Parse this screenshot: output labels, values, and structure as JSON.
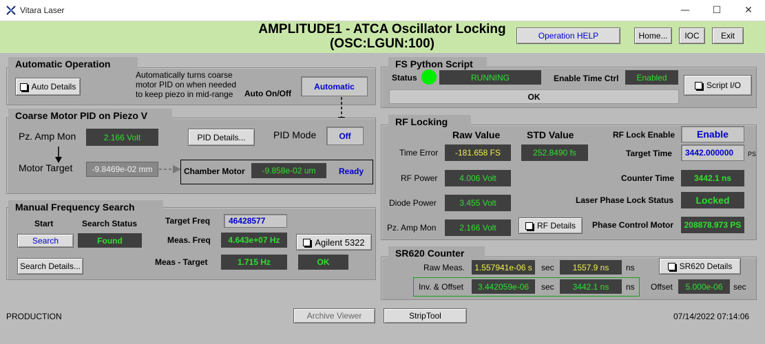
{
  "window": {
    "title": "Vitara Laser",
    "minimize_glyph": "—",
    "maximize_glyph": "☐",
    "close_glyph": "✕"
  },
  "header": {
    "title_line1": "AMPLITUDE1 - ATCA Oscillator Locking",
    "title_line2": "(OSC:LGUN:100)",
    "operation_help": "Operation HELP",
    "home": "Home...",
    "ioc": "IOC",
    "exit": "Exit"
  },
  "auto_op": {
    "title": "Automatic Operation",
    "details_button": "Auto Details",
    "desc": "Automatically turns coarse\nmotor PID on when needed\nto keep piezo in mid-range",
    "onoff_label": "Auto On/Off",
    "onoff_value": "Automatic"
  },
  "coarse": {
    "title": "Coarse Motor PID on Piezo V",
    "pz_amp_label": "Pz. Amp Mon",
    "pz_amp_value": "2.166 Volt",
    "pid_details": "PID Details...",
    "pid_mode_label": "PID Mode",
    "pid_mode_value": "Off",
    "motor_target_label": "Motor Target",
    "motor_target_value": "-9.8469e-02 mm",
    "chamber_label": "Chamber Motor",
    "chamber_value": "-9.858e-02 um",
    "chamber_status": "Ready"
  },
  "manual": {
    "title": "Manual Frequency Search",
    "start_label": "Start",
    "search_status_label": "Search Status",
    "search_button": "Search",
    "search_status": "Found",
    "search_details": "Search Details...",
    "target_freq_label": "Target Freq",
    "target_freq_value": "46428577",
    "meas_freq_label": "Meas. Freq",
    "meas_freq_value": "4.643e+07 Hz",
    "agilent_button": "Agilent 5322",
    "meas_target_label": "Meas - Target",
    "meas_target_value": "1.715 Hz",
    "meas_target_status": "OK"
  },
  "fs_script": {
    "title": "FS Python Script",
    "status_label": "Status",
    "status_value": "RUNNING",
    "status_color": "#00ee00",
    "enable_label": "Enable Time Ctrl",
    "enable_value": "Enabled",
    "script_io": "Script I/O",
    "message": "OK"
  },
  "rf": {
    "title": "RF Locking",
    "raw_header": "Raw Value",
    "std_header": "STD Value",
    "time_error_label": "Time Error",
    "time_error_value": "-181.658 FS",
    "time_error_std": "252.8490 fs",
    "rf_power_label": "RF Power",
    "rf_power_value": "4.006 Volt",
    "diode_label": "Diode Power",
    "diode_value": "3.455 Volt",
    "pz_amp_label": "Pz. Amp Mon",
    "pz_amp_value": "2.166 Volt",
    "rf_details": "RF Details",
    "lock_enable_label": "RF Lock Enable",
    "lock_enable_value": "Enable",
    "target_time_label": "Target Time",
    "target_time_value": "3442.000000",
    "target_time_unit": "PS",
    "counter_time_label": "Counter Time",
    "counter_time_value": "3442.1 ns",
    "phase_lock_label": "Laser Phase Lock Status",
    "phase_lock_value": "Locked",
    "phase_motor_label": "Phase Control Motor",
    "phase_motor_value": "208878.973 PS"
  },
  "sr620": {
    "title": "SR620 Counter",
    "raw_label": "Raw Meas.",
    "raw_value": "1.557941e-06 s",
    "raw_unit": "sec",
    "raw_ns": "1557.9 ns",
    "raw_ns_unit": "ns",
    "details_button": "SR620 Details",
    "inv_label": "Inv. & Offset",
    "inv_value": "3.442059e-06",
    "inv_unit": "sec",
    "inv_ns": "3442.1 ns",
    "inv_ns_unit": "ns",
    "offset_label": "Offset",
    "offset_value": "5.000e-06",
    "offset_unit": "sec"
  },
  "footer": {
    "mode": "PRODUCTION",
    "archive_viewer": "Archive Viewer",
    "striptool": "StripTool",
    "timestamp": "07/14/2022 07:14:06"
  }
}
